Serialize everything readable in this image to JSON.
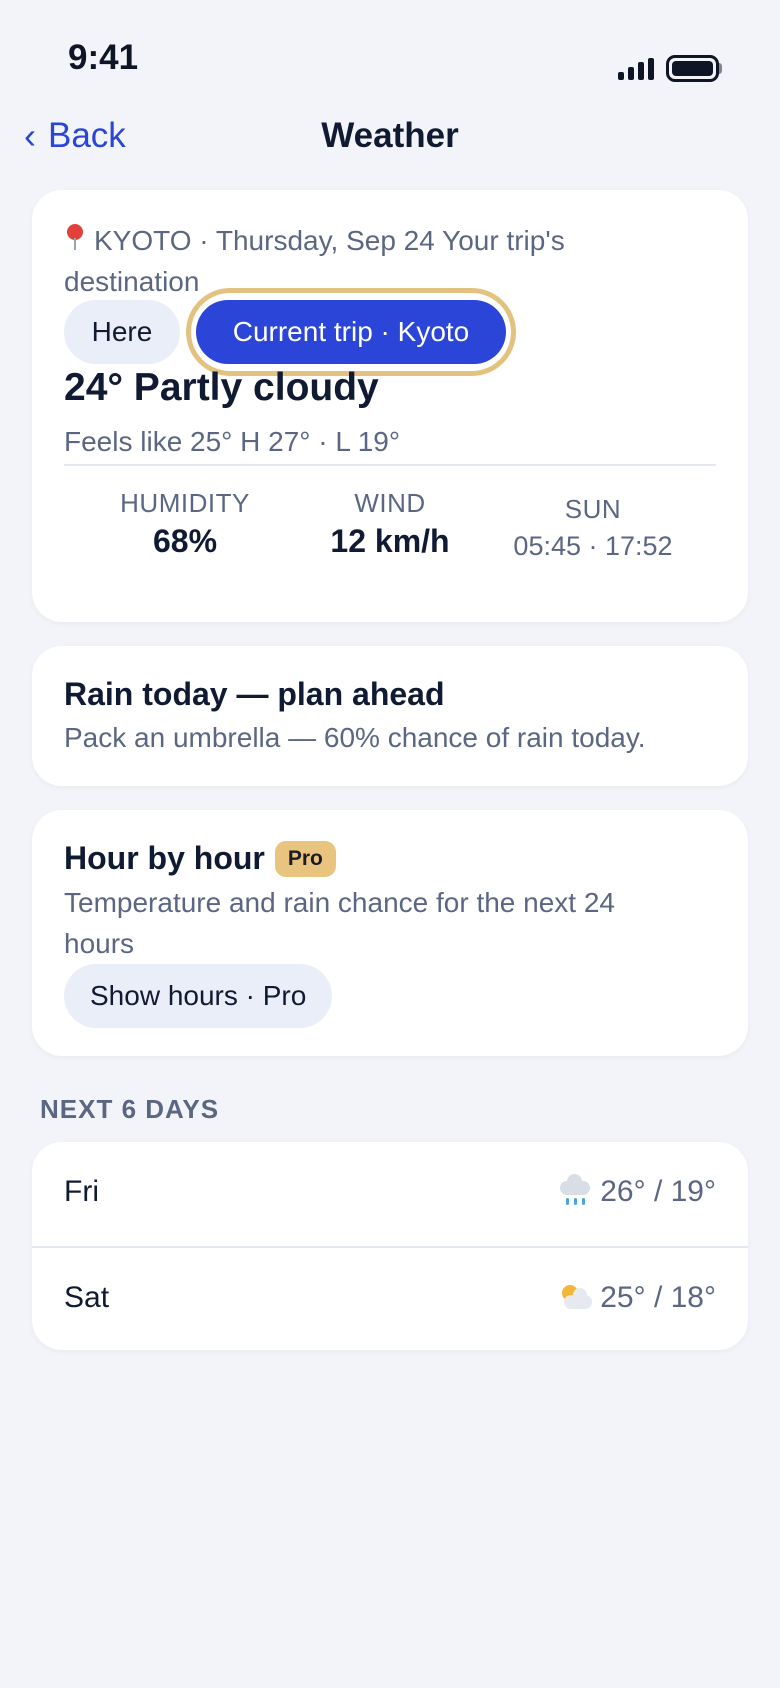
{
  "status_bar": {
    "time": "9:41"
  },
  "nav": {
    "back_label": "Back",
    "title": "Weather"
  },
  "current": {
    "location_line": "KYOTO · Thursday, Sep 24 Your trip's destination",
    "segments": {
      "here": "Here",
      "trip": "Current trip · Kyoto"
    },
    "condition": "24° Partly cloudy",
    "feels": "Feels like 25° H 27° · L 19°",
    "stats": {
      "humidity": {
        "label": "HUMIDITY",
        "value": "68%"
      },
      "wind": {
        "label": "WIND",
        "value": "12 km/h"
      },
      "sun": {
        "label": "SUN",
        "value": "05:45 · 17:52"
      }
    }
  },
  "rain_alert": {
    "title": "Rain today — plan ahead",
    "description": "Pack an umbrella — 60% chance of rain today."
  },
  "hourly": {
    "title": "Hour by hour",
    "badge": "Pro",
    "description": "Temperature and rain chance for the next 24 hours",
    "button_label": "Show hours · Pro"
  },
  "forecast": {
    "header": "NEXT 6 DAYS",
    "days": [
      {
        "day": "Fri",
        "icon": "rain-cloud-icon",
        "temps": "26° / 19°"
      },
      {
        "day": "Sat",
        "icon": "sun-behind-cloud-icon",
        "temps": "25° / 18°"
      }
    ]
  },
  "colors": {
    "accent": "#2a45d8",
    "highlight_ring": "#e3c27f",
    "pro_badge": "#e8c47e",
    "background": "#f2f4f9"
  }
}
